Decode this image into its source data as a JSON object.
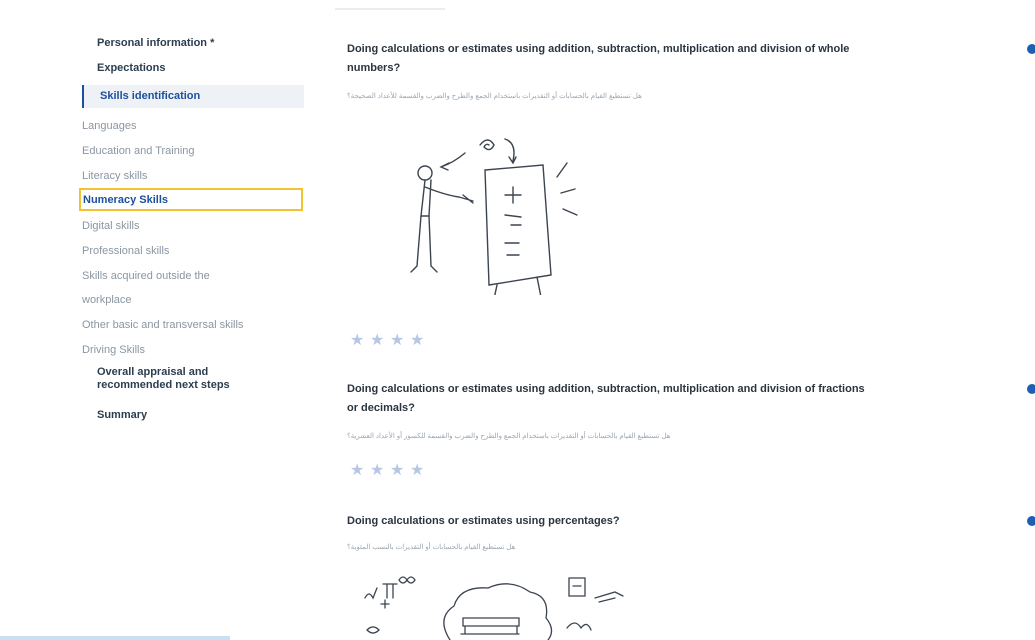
{
  "sidebar": {
    "personal_information": "Personal information *",
    "expectations": "Expectations",
    "skills_identification": "Skills identification",
    "sub_items": [
      "Languages",
      "Education and Training",
      "Literacy skills",
      "Numeracy Skills",
      "Digital skills",
      "Professional skills",
      "Skills acquired outside the",
      "workplace",
      "Other basic and transversal skills",
      "Driving Skills"
    ],
    "overall_line1": "Overall appraisal and",
    "overall_line2": "recommended next steps",
    "summary": "Summary"
  },
  "questions": [
    {
      "line1": "Doing calculations or estimates using addition, subtraction, multiplication and division of whole",
      "line2": "numbers?",
      "subtext": "هل تستطيع القيام بالحسابات أو التقديرات باستخدام الجمع والطرح والضرب والقسمة للأعداد الصحيحة؟",
      "stars": "★★★★"
    },
    {
      "line1": "Doing calculations or estimates using addition, subtraction, multiplication and division of fractions",
      "line2": "or decimals?",
      "subtext": "هل تستطيع القيام بالحسابات أو التقديرات باستخدام الجمع والطرح والضرب والقسمة للكسور أو الأعداد العشرية؟",
      "stars": "★★★★"
    },
    {
      "line1": "Doing calculations or estimates using percentages?",
      "subtext": "هل تستطيع القيام بالحسابات أو التقديرات بالنسب المئوية؟"
    }
  ],
  "colors": {
    "accent": "#1c4f9c",
    "highlight_border": "#f2c230",
    "star": "#b7c7e2",
    "info": "#1d5fb0"
  },
  "icons": {
    "star": "star-icon",
    "info": "info-icon"
  }
}
